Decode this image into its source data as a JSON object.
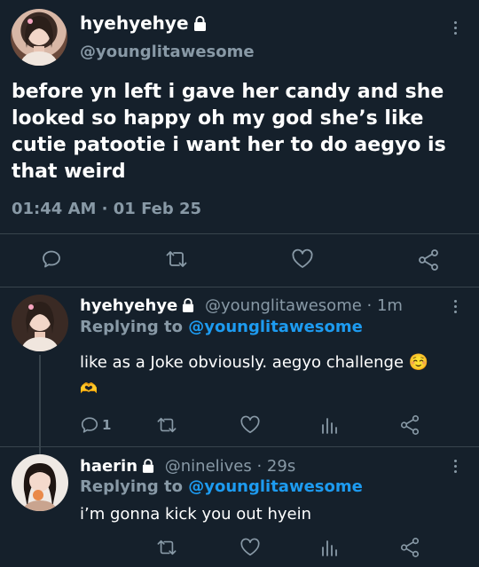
{
  "main_tweet": {
    "display_name": "hyehyehye",
    "handle": "@younglitawesome",
    "text": "before yn left i gave her candy and she looked so happy oh my god she’s like cutie patootie i want her to do aegyo is that weird",
    "timestamp": "01:44 AM · 01 Feb 25"
  },
  "replies": [
    {
      "display_name": "hyehyehye",
      "meta": "@younglitawesome · 1m",
      "replying_label": "Replying to",
      "replying_handle": "@younglitawesome",
      "text": "like as a Joke obviously. aegyo challenge ☺️",
      "emoji_line": "🫶",
      "reply_count": "1"
    },
    {
      "display_name": "haerin",
      "meta": "@ninelives · 29s",
      "replying_label": "Replying to",
      "replying_handle": "@younglitawesome",
      "text": "i’m gonna kick you out hyein"
    }
  ],
  "colors": {
    "background": "#15202b",
    "muted": "#8899a6",
    "link": "#1d9bf0",
    "divider": "#38444d"
  },
  "icons": [
    "lock-icon",
    "more-icon",
    "reply-icon",
    "retweet-icon",
    "like-icon",
    "share-icon",
    "analytics-icon"
  ]
}
